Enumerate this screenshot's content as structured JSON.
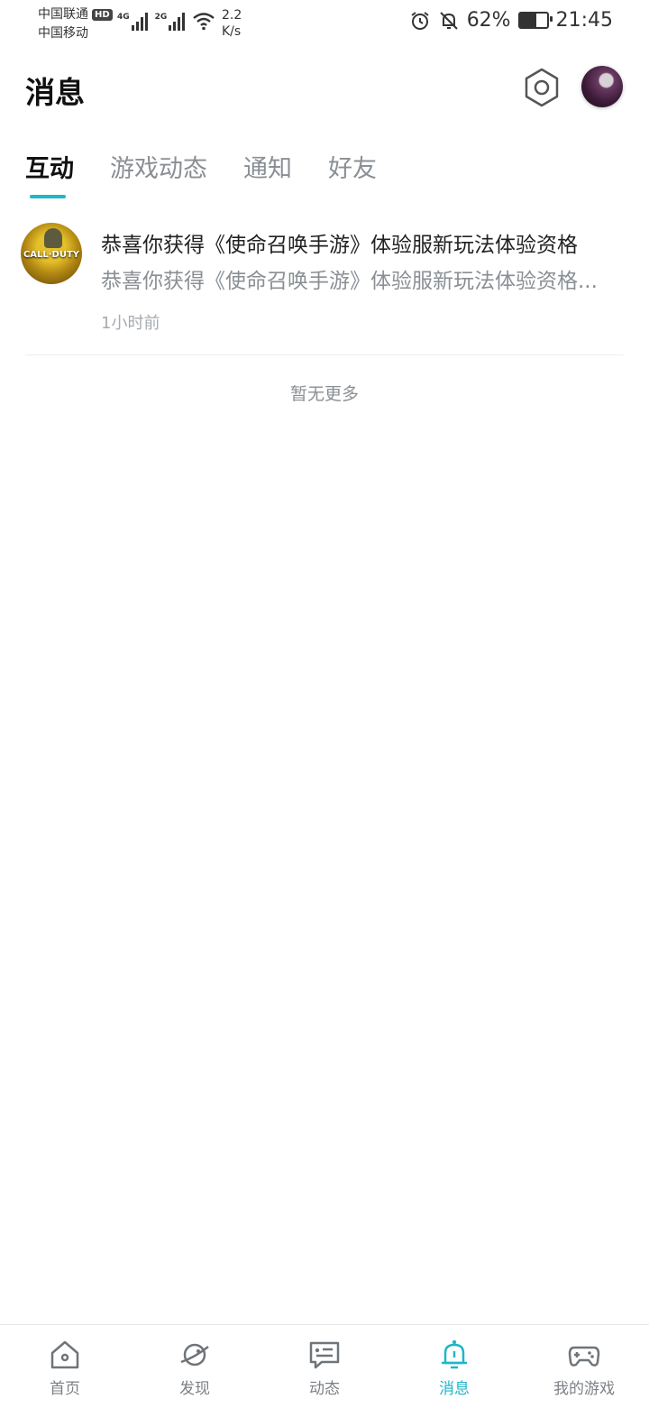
{
  "status_bar": {
    "carrier1": "中国联通",
    "hd": "HD",
    "carrier2": "中国移动",
    "net1": "4G",
    "net2": "2G",
    "speed_value": "2.2",
    "speed_unit": "K/s",
    "battery": "62%",
    "battery_level": 0.62,
    "time": "21:45"
  },
  "header": {
    "title": "消息"
  },
  "tabs": [
    {
      "label": "互动",
      "active": true
    },
    {
      "label": "游戏动态",
      "active": false
    },
    {
      "label": "通知",
      "active": false
    },
    {
      "label": "好友",
      "active": false
    }
  ],
  "messages": [
    {
      "avatar_text": "CALL·DUTY",
      "title": "恭喜你获得《使命召唤手游》体验服新玩法体验资格",
      "preview": "恭喜你获得《使命召唤手游》体验服新玩法体验资格...",
      "time": "1小时前"
    }
  ],
  "list_end": "暂无更多",
  "accent_color": "#1fb6c9",
  "bottom_nav": [
    {
      "label": "首页",
      "icon": "home-icon",
      "active": false
    },
    {
      "label": "发现",
      "icon": "planet-icon",
      "active": false
    },
    {
      "label": "动态",
      "icon": "feed-icon",
      "active": false
    },
    {
      "label": "消息",
      "icon": "bell-icon",
      "active": true
    },
    {
      "label": "我的游戏",
      "icon": "gamepad-icon",
      "active": false
    }
  ]
}
